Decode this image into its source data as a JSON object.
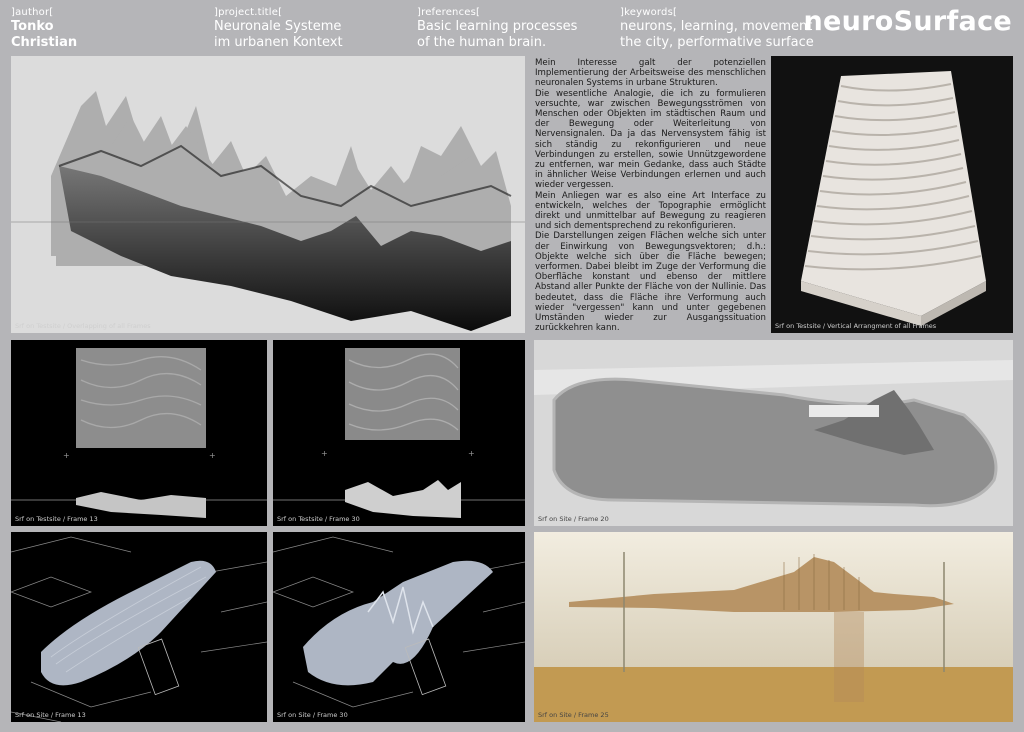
{
  "header": {
    "author_label": "]author[",
    "author_first": "Tonko",
    "author_last": "Christian",
    "project_label": "]project.title[",
    "project_line1": "Neuronale Systeme",
    "project_line2": "im urbanen Kontext",
    "references_label": "]references[",
    "references_line1": "Basic learning processes",
    "references_line2": "of the human brain.",
    "keywords_label": "]keywords[",
    "keywords_line1": "neurons, learning, movement in",
    "keywords_line2": "the city, performative surface",
    "title": "neuroSurface"
  },
  "body": {
    "paragraphs": [
      "Mein Interesse galt der potenziellen Implementierung der Arbeitsweise des menschlichen neuronalen Systems in urbane Strukturen.",
      "Die wesentliche Analogie, die ich zu formulieren versuchte, war zwischen Bewegungsströmen von Menschen oder Objekten im städtischen Raum und der Bewegung oder Weiterleitung von Nervensignalen. Da ja das Nervensystem fähig ist sich ständig zu rekonfigurieren und neue Verbindungen zu erstellen, sowie Unnützgewordene zu entfernen, war mein Gedanke, dass auch Städte in ähnlicher Weise Verbindungen erlernen und auch wieder vergessen.",
      "Mein Anliegen war es also eine Art Interface zu entwickeln, welches der Topographie ermöglicht direkt und unmittelbar auf Bewegung zu reagieren und sich dementsprechend zu rekonfigurieren.",
      "Die Darstellungen zeigen Flächen welche sich unter der Einwirkung von Bewegungsvektoren; d.h.: Objekte welche sich über die Fläche bewegen; verformen. Dabei bleibt im Zuge der Verformung die Oberfläche konstant und ebenso der mittlere Abstand aller Punkte der Fläche von der Nullinie. Das bedeutet, dass die Fläche ihre Verformung auch wieder \"vergessen\" kann und unter gegebenen Umständen wieder zur Ausgangssituation zurückkehren kann."
    ]
  },
  "captions": {
    "overlap": "Srf on Testsite / Overlapping of all Frames",
    "vertical": "Srf on Testsite / Vertical Arrangment of all Frames",
    "test13": "Srf on Testsite / Frame 13",
    "test30": "Srf on Testsite / Frame 30",
    "site20": "Srf on Site / Frame 20",
    "site13": "Srf on Site / Frame 13",
    "site30": "Srf on Site / Frame 30",
    "site25": "Srf on Site / Frame 25"
  }
}
